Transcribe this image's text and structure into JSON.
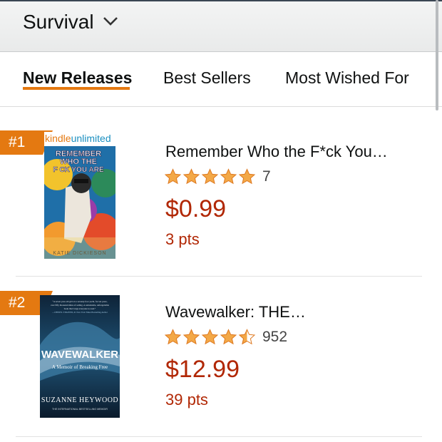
{
  "header": {
    "category": "Survival"
  },
  "tabs": [
    {
      "label": "New Releases",
      "active": true
    },
    {
      "label": "Best Sellers",
      "active": false
    },
    {
      "label": "Most Wished For",
      "active": false
    }
  ],
  "colors": {
    "accent": "#e47911",
    "price": "#b12704",
    "star": "#f3a847"
  },
  "items": [
    {
      "rank": "#1",
      "badge": "kindleunlimited",
      "title": "Remember Who the F*ck You…",
      "rating": 5,
      "review_count": "7",
      "price": "$0.99",
      "points": "3 pts",
      "cover": {
        "title_lines": [
          "REMEMBER",
          "WHO THE",
          "F CK YOU ARE"
        ],
        "author": "KATIE DICKIESON"
      }
    },
    {
      "rank": "#2",
      "title": "Wavewalker: THE…",
      "rating": 4.5,
      "review_count": "952",
      "price": "$12.99",
      "points": "39 pts",
      "cover": {
        "blurb": "\"A seven year-old girl on a seventy-foot yacht, for ten years, over fifty thousand miles of sailing. A remarkable, unforgettable book that I urge everyone to read.\"",
        "blurb_credit": "—CHERYL STRAYED, #1 New York Times Bestselling Author",
        "title": "WAVEWALKER",
        "subtitle": "A Memoir of Breaking Free",
        "author": "SUZANNE HEYWOOD",
        "tagline": "THE INTERNATIONAL BESTSELLING MEMOIR"
      }
    }
  ]
}
